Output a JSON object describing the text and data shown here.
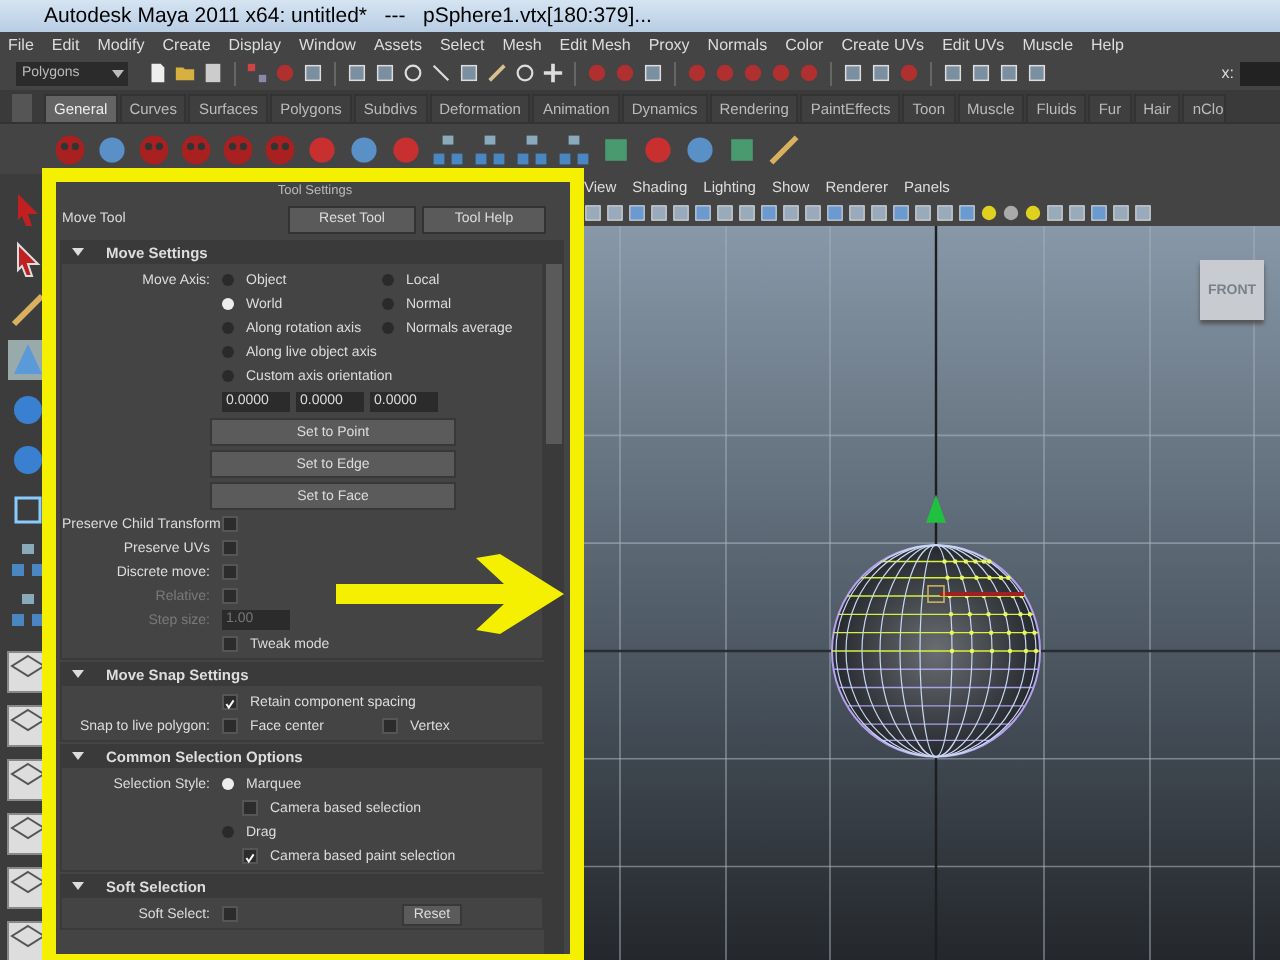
{
  "window": {
    "title": "Autodesk Maya 2011 x64: untitled*   ---   pSphere1.vtx[180:379]..."
  },
  "menu_bar": [
    "File",
    "Edit",
    "Modify",
    "Create",
    "Display",
    "Window",
    "Assets",
    "Select",
    "Mesh",
    "Edit Mesh",
    "Proxy",
    "Normals",
    "Color",
    "Create UVs",
    "Edit UVs",
    "Muscle",
    "Help"
  ],
  "status_line": {
    "mode": "Polygons",
    "field_label": "x:"
  },
  "shelf": {
    "tabs": [
      {
        "label": "General",
        "selected": true
      },
      {
        "label": "Curves",
        "selected": false
      },
      {
        "label": "Surfaces",
        "selected": false
      },
      {
        "label": "Polygons",
        "selected": false
      },
      {
        "label": "Subdivs",
        "selected": false
      },
      {
        "label": "Deformation",
        "selected": false
      },
      {
        "label": "Animation",
        "selected": false
      },
      {
        "label": "Dynamics",
        "selected": false
      },
      {
        "label": "Rendering",
        "selected": false
      },
      {
        "label": "PaintEffects",
        "selected": false
      },
      {
        "label": "Toon",
        "selected": false
      },
      {
        "label": "Muscle",
        "selected": false
      },
      {
        "label": "Fluids",
        "selected": false
      },
      {
        "label": "Fur",
        "selected": false
      },
      {
        "label": "Hair",
        "selected": false
      },
      {
        "label": "nClo",
        "selected": false
      }
    ]
  },
  "tool_settings": {
    "title": "Tool Settings",
    "tool": "Move Tool",
    "buttons": [
      "Reset Tool",
      "Tool Help"
    ],
    "sections": [
      {
        "title": "Move Settings",
        "expanded": true,
        "rows": [
          {
            "kind": "options",
            "label": "Move Axis:",
            "items": [
              {
                "kind": "radio",
                "text": "Object",
                "selected": false
              },
              {
                "kind": "radio",
                "text": "Local",
                "selected": false
              }
            ]
          },
          {
            "kind": "options",
            "items": [
              {
                "kind": "radio",
                "text": "World",
                "selected": true
              },
              {
                "kind": "radio",
                "text": "Normal",
                "selected": false
              }
            ]
          },
          {
            "kind": "options",
            "items": [
              {
                "kind": "radio",
                "text": "Along rotation axis",
                "selected": false
              },
              {
                "kind": "radio",
                "text": "Normals average",
                "selected": false
              }
            ]
          },
          {
            "kind": "options",
            "items": [
              {
                "kind": "radio",
                "text": "Along live object axis",
                "selected": false
              }
            ]
          },
          {
            "kind": "options",
            "items": [
              {
                "kind": "radio",
                "text": "Custom axis orientation",
                "selected": false
              }
            ]
          },
          {
            "kind": "fields",
            "items": [
              {
                "kind": "field",
                "value": "0.0000"
              },
              {
                "kind": "field",
                "value": "0.0000"
              },
              {
                "kind": "field",
                "value": "0.0000"
              }
            ]
          },
          {
            "kind": "button",
            "items": [
              {
                "kind": "button",
                "text": "Set to Point"
              }
            ]
          },
          {
            "kind": "button",
            "items": [
              {
                "kind": "button",
                "text": "Set to Edge"
              }
            ]
          },
          {
            "kind": "button",
            "items": [
              {
                "kind": "button",
                "text": "Set to Face"
              }
            ]
          },
          {
            "kind": "options",
            "label": "Preserve Child Transform",
            "items": [
              {
                "kind": "checkbox",
                "checked": false
              }
            ]
          },
          {
            "kind": "options",
            "label": "Preserve UVs",
            "items": [
              {
                "kind": "checkbox",
                "checked": false
              }
            ]
          },
          {
            "kind": "options",
            "label": "Discrete move:",
            "items": [
              {
                "kind": "checkbox",
                "checked": false
              }
            ]
          },
          {
            "kind": "options",
            "label": "Relative:",
            "disabled": true,
            "items": [
              {
                "kind": "checkbox",
                "checked": false
              }
            ]
          },
          {
            "kind": "options",
            "label": "Step size:",
            "disabled": true,
            "items": [
              {
                "kind": "field",
                "value": "1.00"
              }
            ]
          },
          {
            "kind": "options",
            "items": [
              {
                "kind": "checkbox",
                "text": "Tweak mode",
                "checked": false
              }
            ]
          }
        ]
      },
      {
        "title": "Move Snap Settings",
        "expanded": true,
        "rows": [
          {
            "kind": "options",
            "items": [
              {
                "kind": "checkbox",
                "text": "Retain component spacing",
                "checked": true
              }
            ]
          },
          {
            "kind": "options",
            "label": "Snap to live polygon:",
            "items": [
              {
                "kind": "checkbox",
                "text": "Face center",
                "checked": false
              },
              {
                "kind": "checkbox",
                "text": "Vertex",
                "checked": false
              }
            ]
          }
        ]
      },
      {
        "title": "Common Selection Options",
        "expanded": true,
        "rows": [
          {
            "kind": "options",
            "label": "Selection Style:",
            "items": [
              {
                "kind": "radio",
                "text": "Marquee",
                "selected": true
              }
            ]
          },
          {
            "kind": "suboption",
            "items": [
              {
                "kind": "checkbox",
                "text": "Camera based selection",
                "checked": false
              }
            ]
          },
          {
            "kind": "options",
            "items": [
              {
                "kind": "radio",
                "text": "Drag",
                "selected": false
              }
            ]
          },
          {
            "kind": "suboption",
            "items": [
              {
                "kind": "checkbox",
                "text": "Camera based paint selection",
                "checked": true
              }
            ]
          }
        ]
      },
      {
        "title": "Soft Selection",
        "expanded": true,
        "rows": [
          {
            "kind": "options",
            "label": "Soft Select:",
            "items": [
              {
                "kind": "checkbox",
                "checked": false
              },
              {
                "kind": "button",
                "text": "Reset"
              }
            ]
          }
        ]
      }
    ]
  },
  "viewport": {
    "menu": [
      "View",
      "Shading",
      "Lighting",
      "Show",
      "Renderer",
      "Panels"
    ],
    "view_cube_label": "FRONT"
  }
}
